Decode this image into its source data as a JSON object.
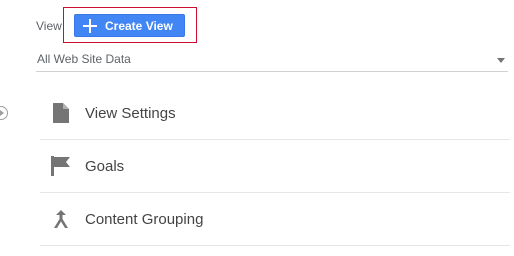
{
  "header": {
    "view_label": "View",
    "create_view_label": "Create View"
  },
  "selector": {
    "value": "All Web Site Data"
  },
  "menu": {
    "items": [
      {
        "label": "View Settings",
        "icon": "document-icon"
      },
      {
        "label": "Goals",
        "icon": "flag-icon"
      },
      {
        "label": "Content Grouping",
        "icon": "merge-icon"
      }
    ]
  },
  "colors": {
    "accent": "#4285f4",
    "highlight": "#c8102e",
    "icon": "#757575"
  }
}
